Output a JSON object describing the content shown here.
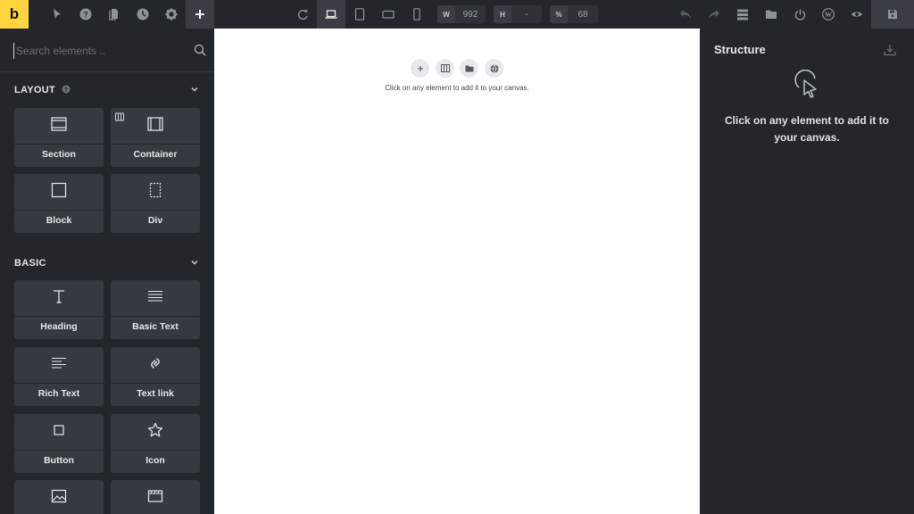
{
  "topbar": {
    "logo": "b",
    "tools": [
      {
        "icon": "pointer-icon"
      },
      {
        "icon": "help-icon"
      },
      {
        "icon": "pages-icon"
      },
      {
        "icon": "history-icon"
      },
      {
        "icon": "gear-icon"
      },
      {
        "icon": "plus-icon",
        "active": true
      }
    ],
    "center": [
      {
        "icon": "refresh-icon"
      },
      {
        "icon": "laptop-icon",
        "active": true
      },
      {
        "icon": "tablet-portrait-icon"
      },
      {
        "icon": "tablet-landscape-icon"
      },
      {
        "icon": "mobile-icon"
      }
    ],
    "width": {
      "label": "W",
      "value": "992"
    },
    "height": {
      "label": "H",
      "value": "-"
    },
    "zoom": {
      "label": "%",
      "value": "68"
    },
    "right": [
      {
        "icon": "undo-icon"
      },
      {
        "icon": "redo-icon"
      },
      {
        "icon": "structure-icon"
      },
      {
        "icon": "folder-icon"
      },
      {
        "icon": "power-icon"
      },
      {
        "icon": "wordpress-icon"
      },
      {
        "icon": "eye-icon"
      },
      {
        "icon": "save-icon"
      }
    ]
  },
  "sidebar": {
    "search_placeholder": "Search elements ..",
    "categories": [
      {
        "title": "LAYOUT",
        "items": [
          "Section",
          "Container",
          "Block",
          "Div"
        ]
      },
      {
        "title": "BASIC",
        "items": [
          "Heading",
          "Basic Text",
          "Rich Text",
          "Text link",
          "Button",
          "Icon",
          "",
          ""
        ]
      }
    ]
  },
  "canvas": {
    "hint": "Click on any element to add it to your canvas."
  },
  "structure": {
    "title": "Structure",
    "message": "Click on any element to add it to your canvas."
  },
  "colors": {
    "accent": "#ffd53e",
    "panel": "#23262a",
    "tile": "#353a40"
  }
}
